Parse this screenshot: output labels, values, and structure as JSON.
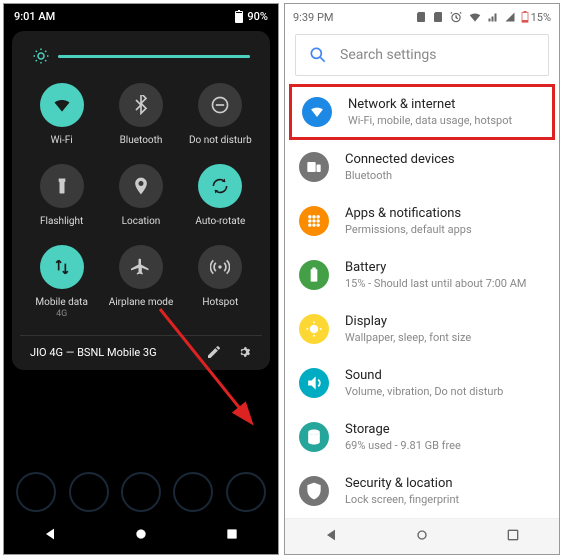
{
  "left": {
    "status": {
      "time": "9:01 AM",
      "battery": "90%"
    },
    "tiles": [
      {
        "label": "Wi-Fi",
        "sub": "",
        "icon": "wifi",
        "on": true
      },
      {
        "label": "Bluetooth",
        "sub": "",
        "icon": "bluetooth",
        "on": false
      },
      {
        "label": "Do not disturb",
        "sub": "",
        "icon": "dnd",
        "on": false
      },
      {
        "label": "Flashlight",
        "sub": "",
        "icon": "flashlight",
        "on": false
      },
      {
        "label": "Location",
        "sub": "",
        "icon": "location",
        "on": false
      },
      {
        "label": "Auto-rotate",
        "sub": "",
        "icon": "rotate",
        "on": true
      },
      {
        "label": "Mobile data",
        "sub": "4G",
        "icon": "data",
        "on": true
      },
      {
        "label": "Airplane mode",
        "sub": "",
        "icon": "airplane",
        "on": false
      },
      {
        "label": "Hotspot",
        "sub": "",
        "icon": "hotspot",
        "on": false
      }
    ],
    "footer": {
      "network": "JIO 4G — BSNL Mobile 3G"
    }
  },
  "right": {
    "status": {
      "time": "9:39 PM",
      "battery": "15%"
    },
    "search_placeholder": "Search settings",
    "items": [
      {
        "title": "Network & internet",
        "sub": "Wi-Fi, mobile, data usage, hotspot",
        "color": "#1e88e5",
        "icon": "wifi",
        "highlight": true
      },
      {
        "title": "Connected devices",
        "sub": "Bluetooth",
        "color": "#757575",
        "icon": "devices"
      },
      {
        "title": "Apps & notifications",
        "sub": "Permissions, default apps",
        "color": "#fb8c00",
        "icon": "apps"
      },
      {
        "title": "Battery",
        "sub": "15% - Should last until about 7:00 AM",
        "color": "#43a047",
        "icon": "battery"
      },
      {
        "title": "Display",
        "sub": "Wallpaper, sleep, font size",
        "color": "#fdd835",
        "icon": "display"
      },
      {
        "title": "Sound",
        "sub": "Volume, vibration, Do not disturb",
        "color": "#00acc1",
        "icon": "sound"
      },
      {
        "title": "Storage",
        "sub": "69% used - 9.81 GB free",
        "color": "#26a69a",
        "icon": "storage"
      },
      {
        "title": "Security & location",
        "sub": "Lock screen, fingerprint",
        "color": "#757575",
        "icon": "security"
      }
    ]
  }
}
